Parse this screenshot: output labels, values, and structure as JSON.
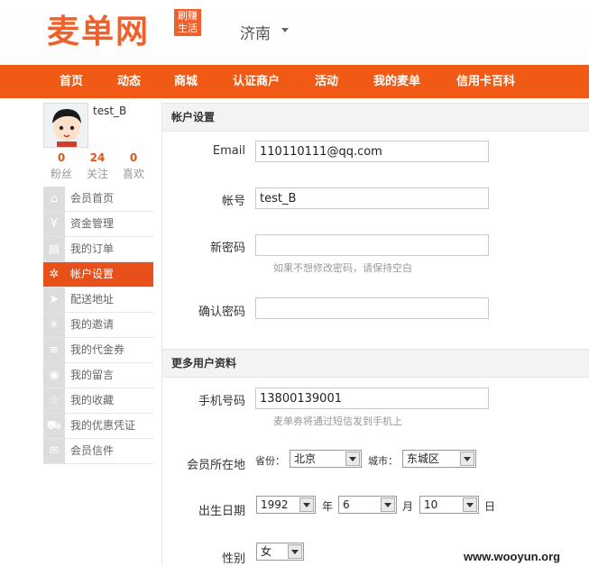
{
  "header": {
    "logo_text": "麦单网",
    "logo_badge": [
      "刷赚",
      "生活"
    ],
    "city": "济南"
  },
  "nav": [
    "首页",
    "动态",
    "商城",
    "认证商户",
    "活动",
    "我的麦单",
    "信用卡百科"
  ],
  "user": {
    "name": "test_B",
    "stats": [
      {
        "num": "0",
        "label": "粉丝"
      },
      {
        "num": "24",
        "label": "关注"
      },
      {
        "num": "0",
        "label": "喜欢"
      }
    ]
  },
  "menu": [
    {
      "label": "会员首页",
      "icon": "home-icon",
      "glyph": "⌂"
    },
    {
      "label": "资金管理",
      "icon": "yen-icon",
      "glyph": "¥"
    },
    {
      "label": "我的订单",
      "icon": "document-icon",
      "glyph": "▤"
    },
    {
      "label": "帐户设置",
      "icon": "gear-icon",
      "glyph": "✲",
      "active": true
    },
    {
      "label": "配送地址",
      "icon": "truck-icon",
      "glyph": "➤"
    },
    {
      "label": "我的邀请",
      "icon": "sparkle-icon",
      "glyph": "✳"
    },
    {
      "label": "我的代金券",
      "icon": "stack-icon",
      "glyph": "≡"
    },
    {
      "label": "我的留言",
      "icon": "users-icon",
      "glyph": "◉"
    },
    {
      "label": "我的收藏",
      "icon": "star-icon",
      "glyph": "☆"
    },
    {
      "label": "我的优惠凭证",
      "icon": "cart-icon",
      "glyph": "⛟"
    },
    {
      "label": "会员信件",
      "icon": "mail-icon",
      "glyph": "✉"
    }
  ],
  "account": {
    "section_title": "帐户设置",
    "email_label": "Email",
    "email_value": "110110111@qq.com",
    "account_label": "帐号",
    "account_value": "test_B",
    "new_password_label": "新密码",
    "new_password_value": "",
    "new_password_hint": "如果不想修改密码，请保持空白",
    "confirm_password_label": "确认密码",
    "confirm_password_value": ""
  },
  "profile": {
    "section_title": "更多用户资料",
    "phone_label": "手机号码",
    "phone_value": "13800139001",
    "phone_hint": "麦单券将通过短信发到手机上",
    "location_label": "会员所在地",
    "province_label": "省份：",
    "province_value": "北京",
    "city_label": "城市：",
    "city_value": "东城区",
    "birth_label": "出生日期",
    "birth_year": "1992",
    "year_unit": "年",
    "birth_month": "6",
    "month_unit": "月",
    "birth_day": "10",
    "day_unit": "日",
    "gender_label": "性别",
    "gender_value": "女"
  },
  "watermark": "www.wooyun.org"
}
